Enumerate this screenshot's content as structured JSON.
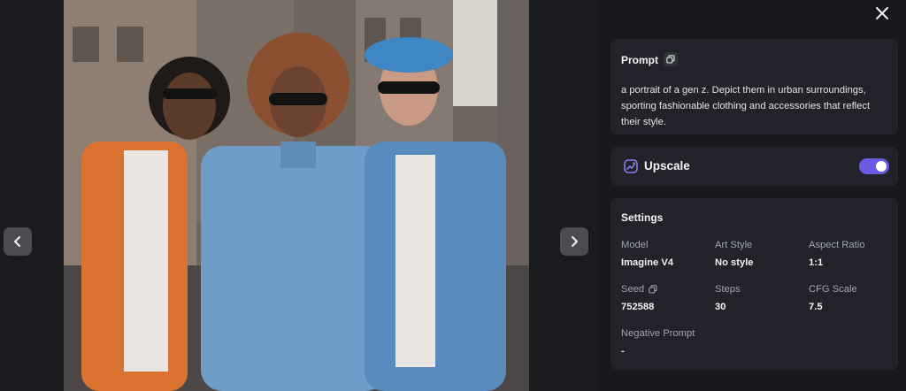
{
  "viewer": {
    "image_alt": "Three young people in denim and colorful jackets wearing sunglasses on a city street",
    "prev_icon": "chevron-left-icon",
    "next_icon": "chevron-right-icon"
  },
  "panel": {
    "close_icon": "close-icon",
    "prompt": {
      "title": "Prompt",
      "copy_icon": "copy-icon",
      "text": "a portrait of a gen z. Depict them in urban surroundings, sporting fashionable clothing and accessories that reflect their style."
    },
    "upscale": {
      "label": "Upscale",
      "icon": "upscale-icon",
      "enabled": true,
      "accent_color": "#6a5be0"
    },
    "settings": {
      "title": "Settings",
      "model_label": "Model",
      "model_value": "Imagine V4",
      "art_style_label": "Art Style",
      "art_style_value": "No style",
      "aspect_label": "Aspect Ratio",
      "aspect_value": "1:1",
      "seed_label": "Seed",
      "seed_value": "752588",
      "steps_label": "Steps",
      "steps_value": "30",
      "cfg_label": "CFG Scale",
      "cfg_value": "7.5",
      "negative_label": "Negative Prompt",
      "negative_value": "-"
    }
  }
}
